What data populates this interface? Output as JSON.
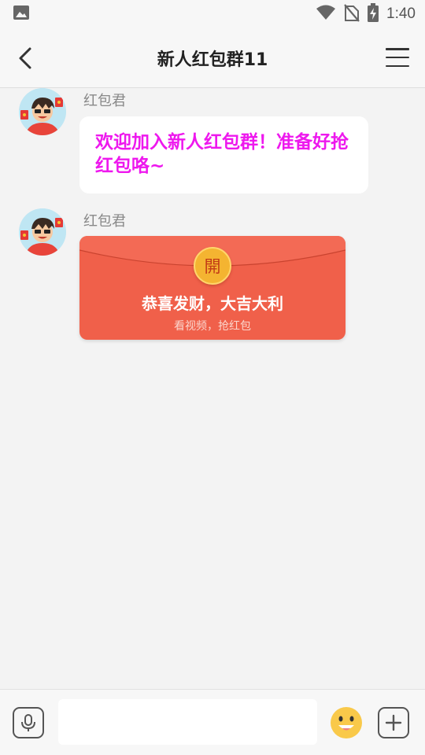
{
  "status_bar": {
    "time": "1:40",
    "icons": [
      "image-icon",
      "wifi-icon",
      "no-sim-icon",
      "battery-charging-icon"
    ]
  },
  "nav": {
    "title": "新人红包群11",
    "back_icon": "chevron-left-icon",
    "menu_icon": "menu-icon"
  },
  "messages": [
    {
      "sender": "红包君",
      "type": "text",
      "text": "欢迎加入新人红包群！准备好抢红包咯~",
      "text_color": "#ee18ee"
    },
    {
      "sender": "红包君",
      "type": "red_packet",
      "open_label": "開",
      "title": "恭喜发财，大吉大利",
      "subtitle": "看视频，抢红包",
      "color": "#f0604a"
    }
  ],
  "input_bar": {
    "value": "",
    "voice_icon": "microphone-icon",
    "emoji_icon": "smiley-icon",
    "plus_icon": "plus-icon"
  }
}
